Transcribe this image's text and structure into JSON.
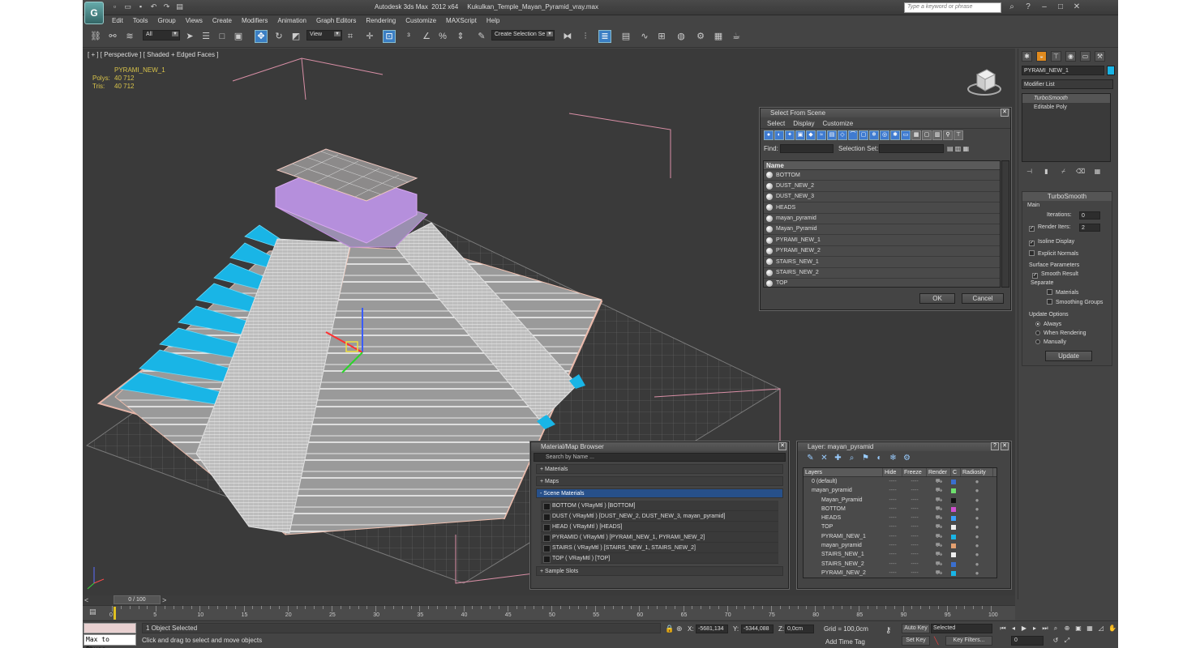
{
  "window": {
    "title": "Autodesk 3ds Max  2012 x64     Kukulkan_Temple_Mayan_Pyramid_vray.max",
    "search_placeholder": "Type a keyword or phrase",
    "logo": "max-logo"
  },
  "menu": [
    "Edit",
    "Tools",
    "Group",
    "Views",
    "Create",
    "Modifiers",
    "Animation",
    "Graph Editors",
    "Rendering",
    "Customize",
    "MAXScript",
    "Help"
  ],
  "toolbar": {
    "selection_filter": "All",
    "reference_coord": "View",
    "named_selection": "Create Selection Se"
  },
  "viewport": {
    "label": "[ + ] [ Perspective ] [ Shaded + Edged Faces ]",
    "object_name": "PYRAMI_NEW_1",
    "polys_label": "Polys:",
    "polys_value": "40 712",
    "tris_label": "Tris:",
    "tris_value": "40 712"
  },
  "select_from_scene": {
    "title": "Select From Scene",
    "menu": [
      "Select",
      "Display",
      "Customize"
    ],
    "find_label": "Find:",
    "selection_set_label": "Selection Set:",
    "column_name": "Name",
    "items": [
      "BOTTOM",
      "DUST_NEW_2",
      "DUST_NEW_3",
      "HEADS",
      "mayan_pyramid",
      "Mayan_Pyramid",
      "PYRAMI_NEW_1",
      "PYRAMI_NEW_2",
      "STAIRS_NEW_1",
      "STAIRS_NEW_2",
      "TOP"
    ],
    "ok": "OK",
    "cancel": "Cancel"
  },
  "material_browser": {
    "title": "Material/Map Browser",
    "search_placeholder": "Search by Name ...",
    "cat_materials": "+ Materials",
    "cat_maps": "+ Maps",
    "cat_scene": "- Scene Materials",
    "scene_materials": [
      "BOTTOM  ( VRayMtl )  [BOTTOM]",
      "DUST  ( VRayMtl )  [DUST_NEW_2, DUST_NEW_3, mayan_pyramid]",
      "HEAD  ( VRayMtl )  [HEADS]",
      "PYRAMID  ( VRayMtl )  [PYRAMI_NEW_1, PYRAMI_NEW_2]",
      "STAIRS  ( VRayMtl )  [STAIRS_NEW_1, STAIRS_NEW_2]",
      "TOP  ( VRayMtl )  [TOP]"
    ],
    "cat_sample": "+ Sample Slots"
  },
  "layer_panel": {
    "title": "Layer: mayan_pyramid",
    "col_layers": "Layers",
    "col_hide": "Hide",
    "col_freeze": "Freeze",
    "col_render": "Render",
    "col_c": "C",
    "col_radiosity": "Radiosity",
    "rows": [
      {
        "name": "0 (default)",
        "indent": 0,
        "color": "#3a6fd0"
      },
      {
        "name": "mayan_pyramid",
        "indent": 0,
        "color": "#6ee06e"
      },
      {
        "name": "Mayan_Pyramid",
        "indent": 1,
        "color": "#111111"
      },
      {
        "name": "BOTTOM",
        "indent": 1,
        "color": "#d04fd0"
      },
      {
        "name": "HEADS",
        "indent": 1,
        "color": "#3aa0ff"
      },
      {
        "name": "TOP",
        "indent": 1,
        "color": "#f0f0f0"
      },
      {
        "name": "PYRAMI_NEW_1",
        "indent": 1,
        "color": "#19b5e6"
      },
      {
        "name": "mayan_pyramid",
        "indent": 1,
        "color": "#e4a070"
      },
      {
        "name": "STAIRS_NEW_1",
        "indent": 1,
        "color": "#f0f0f0"
      },
      {
        "name": "STAIRS_NEW_2",
        "indent": 1,
        "color": "#3a6fd0"
      },
      {
        "name": "PYRAMI_NEW_2",
        "indent": 1,
        "color": "#19b5e6"
      }
    ]
  },
  "command_panel": {
    "object_name": "PYRAMI_NEW_1",
    "object_color": "#19b5e6",
    "modifier_list": "Modifier List",
    "stack": [
      "TurboSmooth",
      "Editable Poly"
    ],
    "rollout_title": "TurboSmooth",
    "main_label": "Main",
    "iterations_label": "Iterations:",
    "iterations_value": "0",
    "render_iters_label": "Render Iters:",
    "render_iters_value": "2",
    "isoline": "Isoline Display",
    "explicit": "Explicit Normals",
    "surface_params": "Surface Parameters",
    "smooth_result": "Smooth Result",
    "separate": "Separate",
    "materials": "Materials",
    "smoothing_groups": "Smoothing Groups",
    "update_options": "Update Options",
    "always": "Always",
    "when_rendering": "When Rendering",
    "manually": "Manually",
    "update_button": "Update"
  },
  "timeline": {
    "frame_display": "0 / 100",
    "ticks": [
      "0",
      "5",
      "10",
      "15",
      "20",
      "25",
      "30",
      "35",
      "40",
      "45",
      "50",
      "55",
      "60",
      "65",
      "70",
      "75",
      "80",
      "85",
      "90",
      "95",
      "100"
    ]
  },
  "status": {
    "maxscript": "Max to Physc.",
    "selection": "1 Object Selected",
    "hint": "Click and drag to select and move objects",
    "x_label": "X:",
    "x_value": "-5681,134",
    "y_label": "Y:",
    "y_value": "-5344,088",
    "z_label": "Z:",
    "z_value": "0,0cm",
    "grid": "Grid = 100,0cm",
    "add_time_tag": "Add Time Tag",
    "auto_key": "Auto Key",
    "set_key": "Set Key",
    "selected": "Selected",
    "key_filters": "Key Filters...",
    "frame": "0"
  }
}
